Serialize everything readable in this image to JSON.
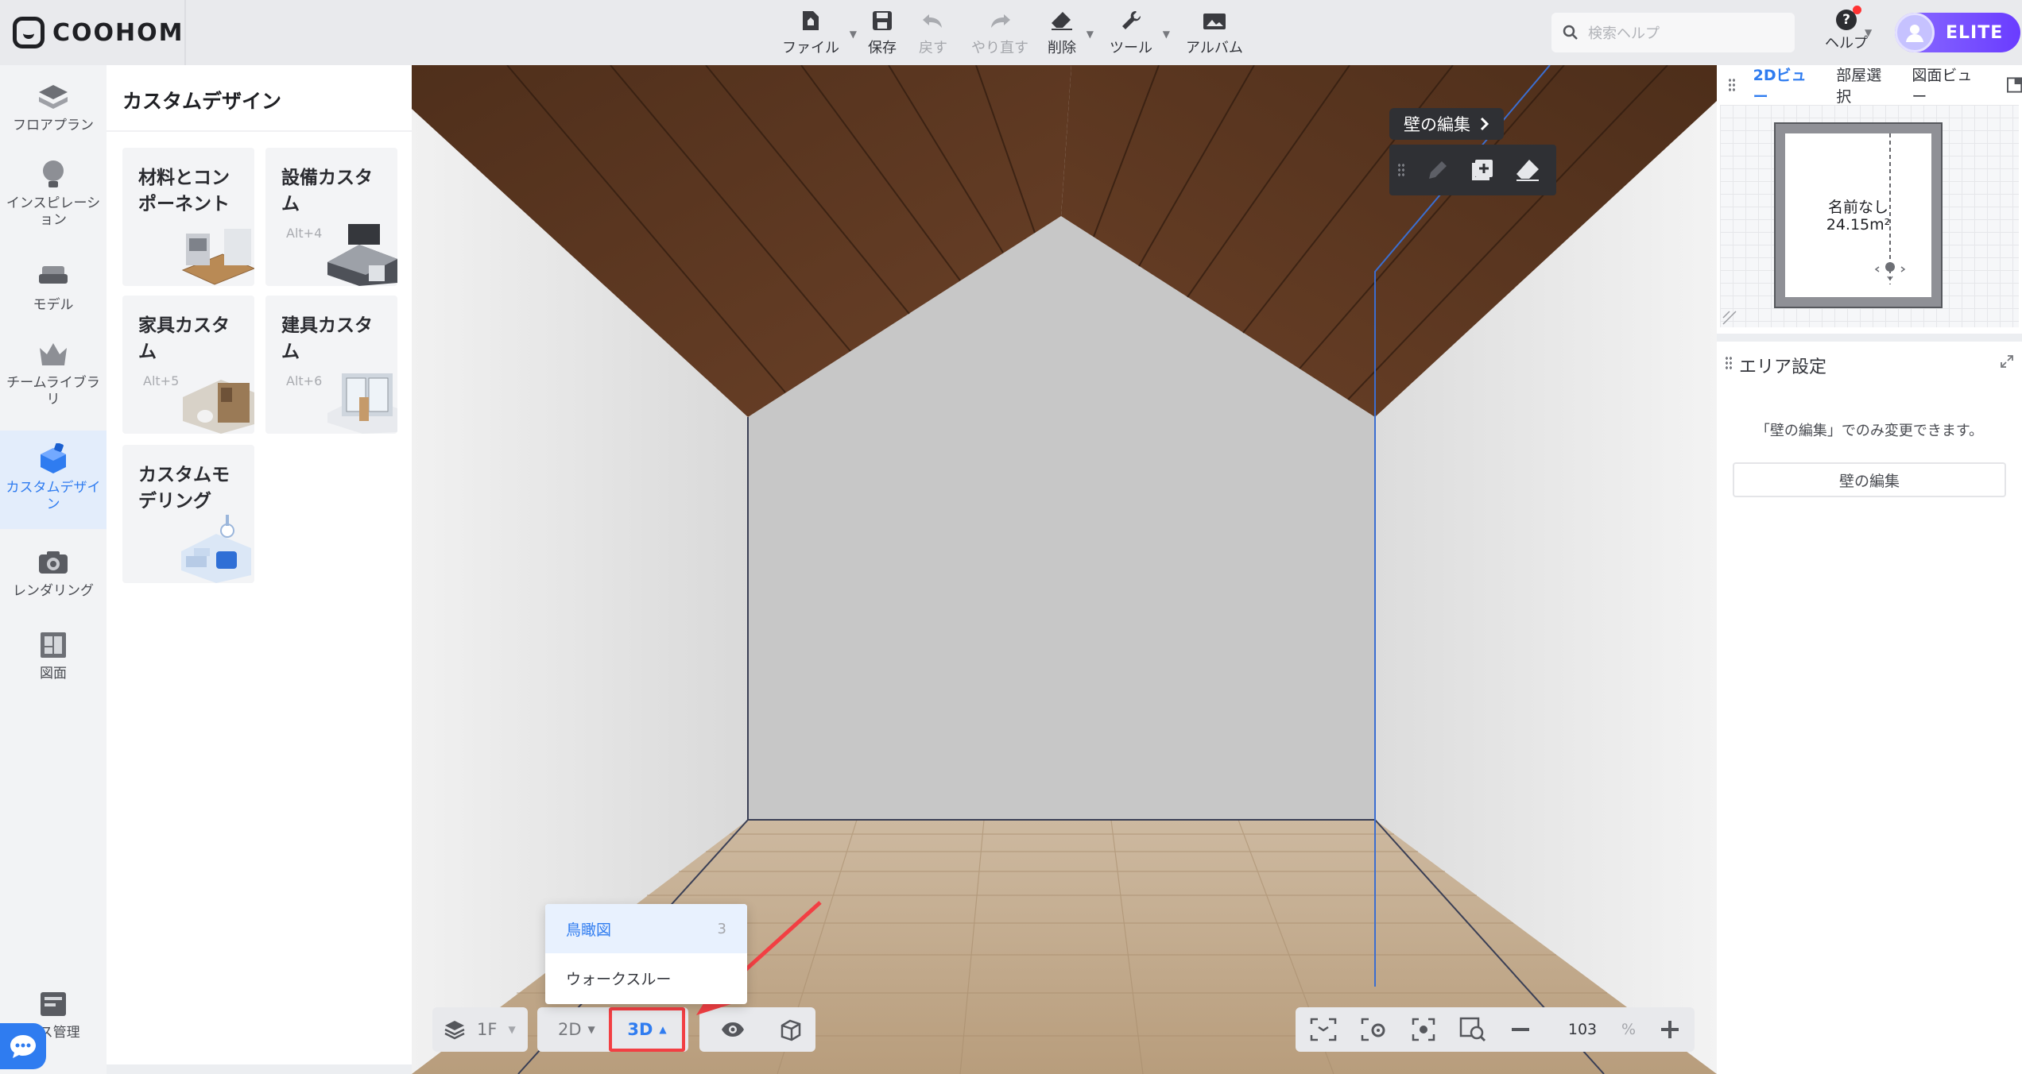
{
  "app": {
    "logo_text": "COOHOM"
  },
  "toolbar": {
    "file": "ファイル",
    "save": "保存",
    "undo": "戻す",
    "redo": "やり直す",
    "delete": "削除",
    "tools": "ツール",
    "album": "アルバム"
  },
  "search": {
    "placeholder": "検索ヘルプ"
  },
  "help": {
    "label": "ヘルプ"
  },
  "account": {
    "badge": "ELITE"
  },
  "rail": {
    "items": [
      {
        "label": "フロアプラン",
        "icon": "floor-plan-icon"
      },
      {
        "label": "インスピレーション",
        "icon": "lightbulb-icon"
      },
      {
        "label": "モデル",
        "icon": "sofa-icon"
      },
      {
        "label": "チームライブラリ",
        "icon": "crown-icon"
      },
      {
        "label": "カスタムデザイン",
        "icon": "custom-design-icon",
        "active": true
      },
      {
        "label": "レンダリング",
        "icon": "camera-icon"
      },
      {
        "label": "図面",
        "icon": "drawing-icon"
      },
      {
        "label": "ース管理",
        "icon": "resource-management-icon"
      }
    ]
  },
  "panel": {
    "title": "カスタムデザイン",
    "cards": [
      {
        "title": "材料とコンポーネント",
        "shortcut": ""
      },
      {
        "title": "設備カスタム",
        "shortcut": "Alt+4"
      },
      {
        "title": "家具カスタム",
        "shortcut": "Alt+5"
      },
      {
        "title": "建具カスタム",
        "shortcut": "Alt+6"
      },
      {
        "title": "カスタムモデリング",
        "shortcut": ""
      }
    ]
  },
  "viewport": {
    "wall_edit_label": "壁の編集",
    "floor_label": "1F",
    "view_2d": "2D",
    "view_3d": "3D",
    "mode_menu": [
      {
        "label": "鳥瞰図",
        "shortcut": "3",
        "selected": true
      },
      {
        "label": "ウォークスルー",
        "shortcut": ""
      }
    ],
    "zoom_value": "103",
    "zoom_unit": "%"
  },
  "view2d": {
    "tabs": [
      "2Dビュー",
      "部屋選択",
      "図面ビュー"
    ],
    "room_name": "名前なし",
    "room_area": "24.15m²"
  },
  "area_panel": {
    "title": "エリア設定",
    "message": "「壁の編集」でのみ変更できます。",
    "button": "壁の編集"
  },
  "colors": {
    "accent": "#2f7cf0",
    "highlight": "#f23f43",
    "elite": "#7b52ff"
  }
}
